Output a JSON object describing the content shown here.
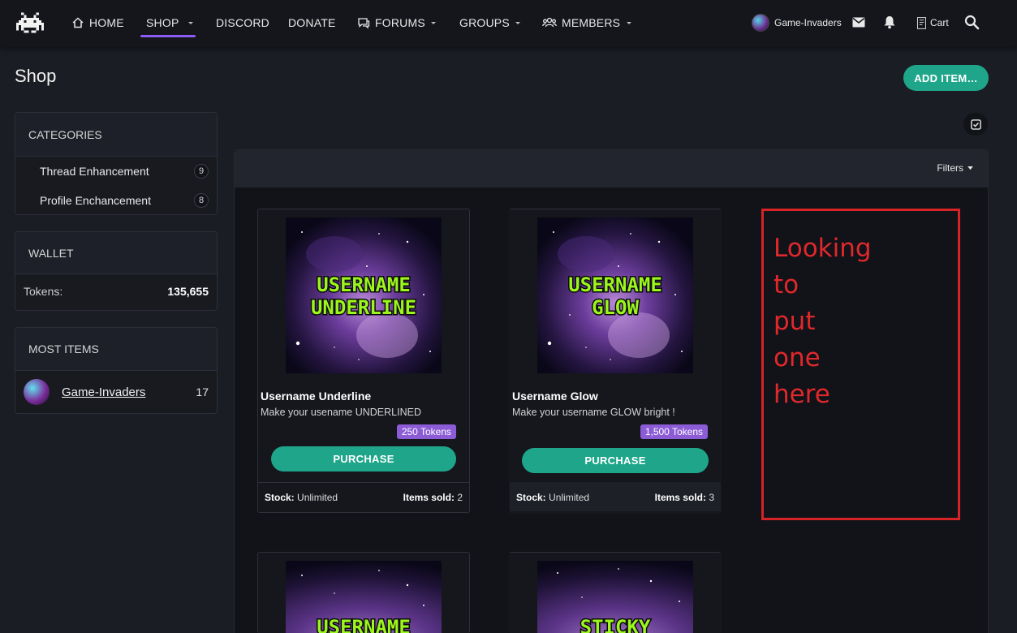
{
  "nav": {
    "items": [
      {
        "label": "HOME",
        "icon": "home-icon"
      },
      {
        "label": "SHOP",
        "active": true
      },
      {
        "label": "DISCORD"
      },
      {
        "label": "DONATE"
      },
      {
        "label": "FORUMS",
        "icon": "chat-icon"
      },
      {
        "label": "GROUPS"
      },
      {
        "label": "MEMBERS",
        "icon": "members-icon"
      }
    ],
    "username": "Game-Invaders",
    "cart_label": "Cart",
    "accent_color": "#8b5cf6"
  },
  "header": {
    "title": "Shop",
    "add_item_label": "ADD ITEM…"
  },
  "sidebar": {
    "categories": {
      "title": "CATEGORIES",
      "items": [
        {
          "label": "Thread Enhancement",
          "count": "9"
        },
        {
          "label": "Profile Enchancement",
          "count": "8"
        }
      ]
    },
    "wallet": {
      "title": "WALLET",
      "label": "Tokens:",
      "value": "135,655"
    },
    "most_items": {
      "title": "MOST ITEMS",
      "user": "Game-Invaders",
      "count": "17"
    }
  },
  "main": {
    "filters_label": "Filters",
    "items": [
      {
        "image_line1": "USERNAME",
        "image_line2": "UNDERLINE",
        "title": "Username Underline",
        "description": "Make your usename UNDERLINED",
        "price": "250 Tokens",
        "purchase_label": "PURCHASE",
        "stock_label": "Stock:",
        "stock_value": "Unlimited",
        "sold_label": "Items sold:",
        "sold_value": "2"
      },
      {
        "image_line1": "USERNAME",
        "image_line2": "GLOW",
        "title": "Username Glow",
        "description": "Make your username GLOW bright !",
        "price": "1,500 Tokens",
        "purchase_label": "PURCHASE",
        "stock_label": "Stock:",
        "stock_value": "Unlimited",
        "sold_label": "Items sold:",
        "sold_value": "3"
      },
      {
        "image_line1": "USERNAME"
      },
      {
        "image_line1": "STICKY"
      }
    ],
    "annotation": "Looking to put one here"
  },
  "colors": {
    "button_green": "#1fa68a",
    "price_purple": "#8b5cd6",
    "annotation_red": "#d72226",
    "pixel_text_green": "#9cf51c"
  }
}
